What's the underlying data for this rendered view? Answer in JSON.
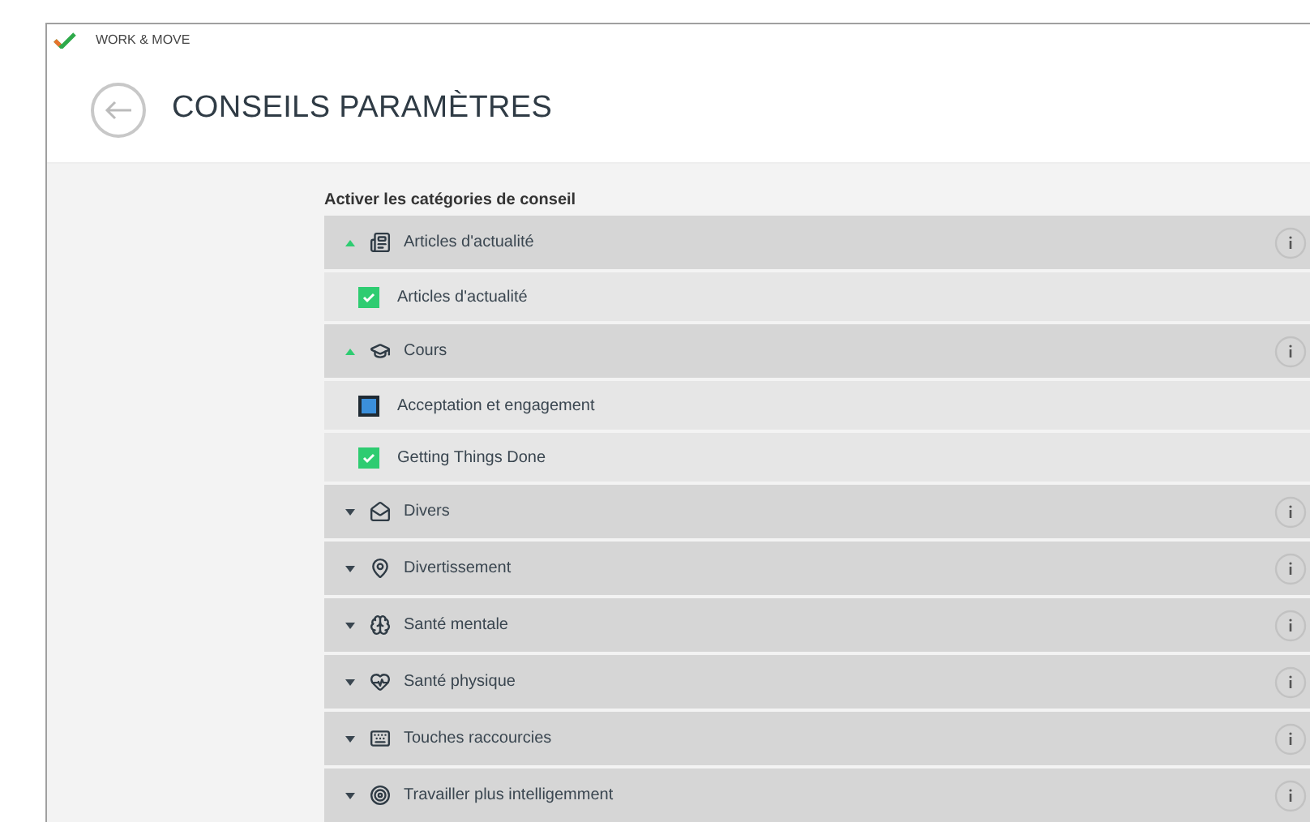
{
  "app": {
    "name": "WORK & MOVE"
  },
  "header": {
    "title": "CONSEILS PARAMÈTRES"
  },
  "section": {
    "label": "Activer les catégories de conseil"
  },
  "categories": [
    {
      "label": "Articles d'actualité",
      "expanded": true,
      "items": [
        {
          "label": "Articles d'actualité",
          "checked": true
        }
      ]
    },
    {
      "label": "Cours",
      "expanded": true,
      "items": [
        {
          "label": "Acceptation et engagement",
          "checked": false
        },
        {
          "label": "Getting Things Done",
          "checked": true
        }
      ]
    },
    {
      "label": "Divers",
      "expanded": false
    },
    {
      "label": "Divertissement",
      "expanded": false
    },
    {
      "label": "Santé mentale",
      "expanded": false
    },
    {
      "label": "Santé physique",
      "expanded": false
    },
    {
      "label": "Touches raccourcies",
      "expanded": false
    },
    {
      "label": "Travailler plus intelligemment",
      "expanded": false
    }
  ]
}
